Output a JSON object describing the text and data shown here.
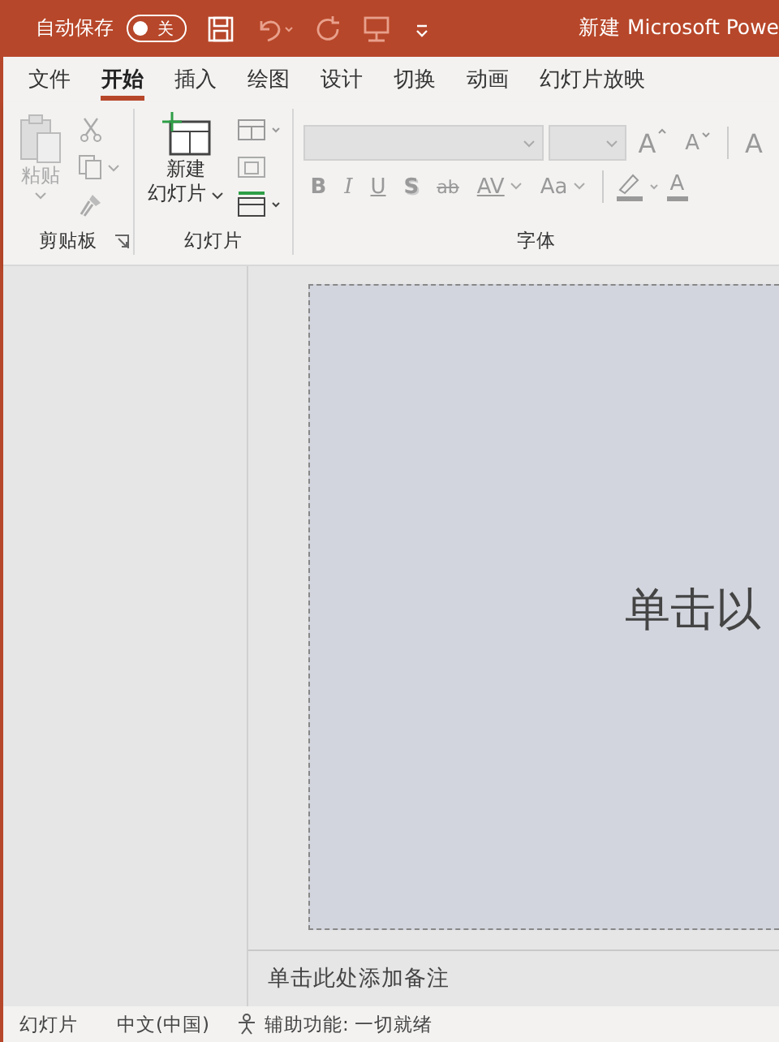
{
  "title_bar": {
    "autosave_label": "自动保存",
    "autosave": {
      "on": false,
      "label": "关"
    },
    "title": "新建 Microsoft Powe"
  },
  "tabs": [
    {
      "label": "文件",
      "selected": false
    },
    {
      "label": "开始",
      "selected": true
    },
    {
      "label": "插入",
      "selected": false
    },
    {
      "label": "绘图",
      "selected": false
    },
    {
      "label": "设计",
      "selected": false
    },
    {
      "label": "切换",
      "selected": false
    },
    {
      "label": "动画",
      "selected": false
    },
    {
      "label": "幻灯片放映",
      "selected": false
    }
  ],
  "ribbon": {
    "clipboard": {
      "paste_label": "粘贴",
      "group_label": "剪贴板"
    },
    "slides": {
      "new_slide_label": [
        "新建",
        "幻灯片"
      ],
      "group_label": "幻灯片"
    },
    "font": {
      "grow": "A",
      "shrink": "A",
      "clear": "A",
      "buttons": [
        {
          "label": "B",
          "kind": "bold"
        },
        {
          "label": "I",
          "kind": "italic"
        },
        {
          "label": "U",
          "kind": "underline"
        },
        {
          "label": "S",
          "kind": "shadow"
        },
        {
          "label": "ab",
          "kind": "strike"
        },
        {
          "label": "AV",
          "kind": "spacing"
        },
        {
          "label": "Aa",
          "kind": "case"
        }
      ],
      "font_color_label": "A",
      "group_label": "字体"
    }
  },
  "slide": {
    "placeholder": "单击以"
  },
  "notes": {
    "placeholder": "单击此处添加备注"
  },
  "status_bar": {
    "slide": "幻灯片",
    "language": "中文(中国)",
    "accessibility": "辅助功能: 一切就绪"
  }
}
